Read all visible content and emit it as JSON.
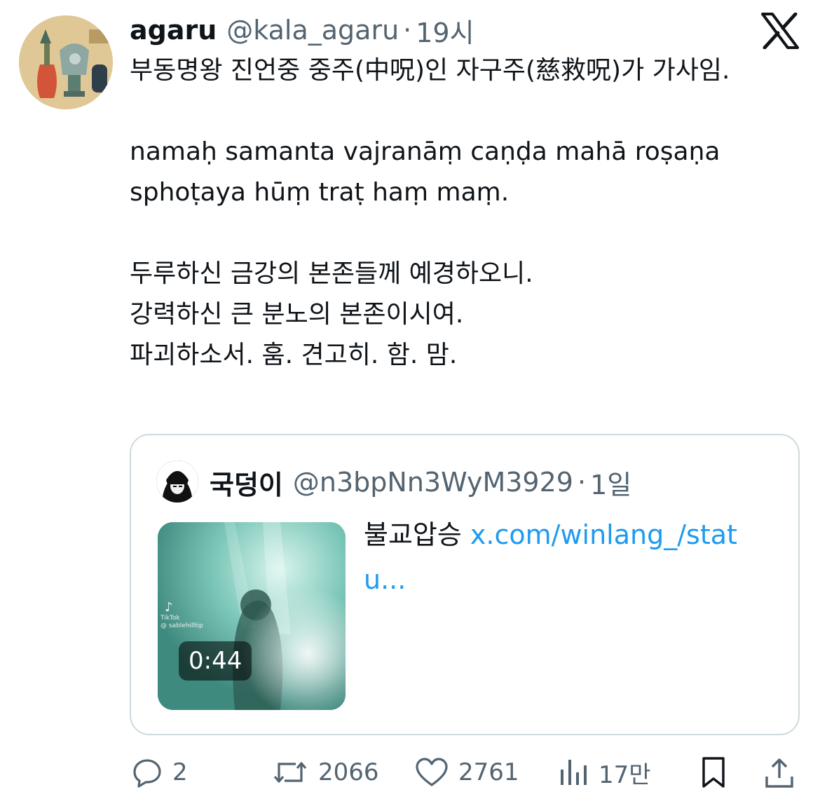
{
  "tweet": {
    "author_name": "agaru",
    "handle": "@kala_agaru",
    "separator": "·",
    "time": "19시",
    "text": "부동명왕 진언중 중주(中呪)인 자구주(慈救呪)가 가사임.\n\nnamaḥ samanta vajranāṃ caṇḍa mahā roṣaṇa sphoṭaya hūṃ traṭ haṃ maṃ.\n\n두루하신 금강의 본존들께 예경하오니.\n강력하신 큰 분노의 본존이시여.\n파괴하소서. 훔. 견고히. 함. 맘."
  },
  "quote": {
    "author_name": "국덩이",
    "handle": "@n3bpNn3WyM3929",
    "separator": "·",
    "time": "1일",
    "text": "불교압승 ",
    "link_text": "x.com/winlang_/statu...",
    "media": {
      "watermark_brand": "TikTok",
      "watermark_user": "@ sablehilltip",
      "duration": "0:44"
    }
  },
  "actions": {
    "replies": "2",
    "reposts": "2066",
    "likes": "2761",
    "views": "17만"
  },
  "icons": {
    "brand": "x-logo-icon",
    "reply": "reply-icon",
    "repost": "repost-icon",
    "like": "heart-icon",
    "views": "views-chart-icon",
    "bookmark": "bookmark-icon",
    "share": "share-icon"
  },
  "colors": {
    "text": "#0f1419",
    "secondary": "#536471",
    "link": "#1d9bf0",
    "border": "#cfd9de"
  }
}
